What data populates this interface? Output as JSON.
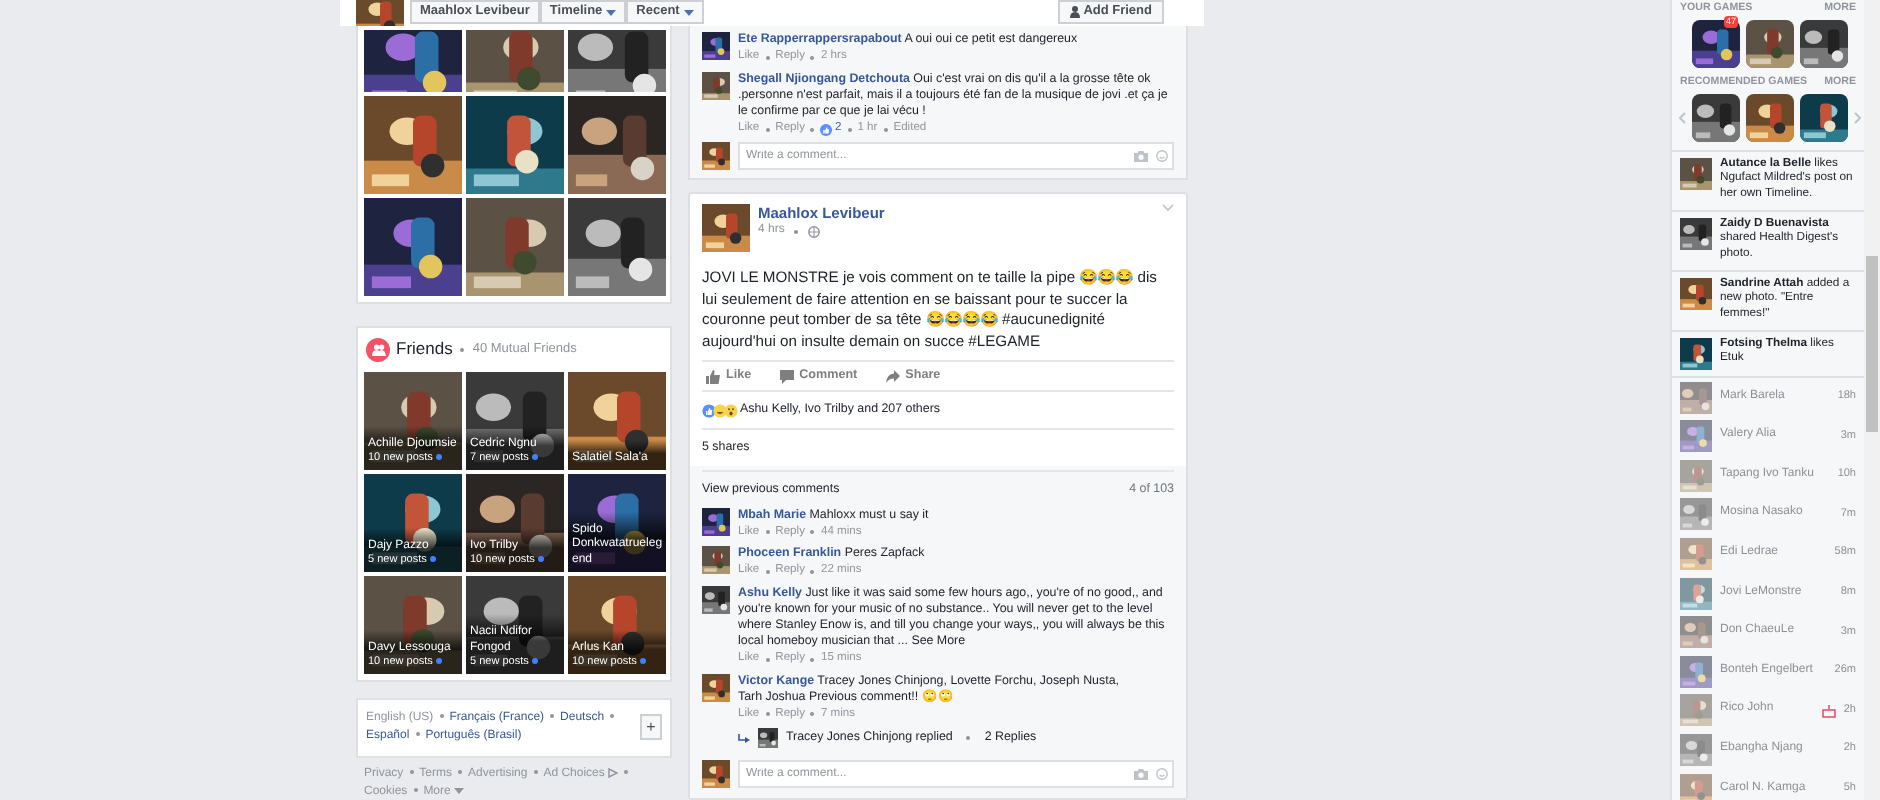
{
  "profile_bar": {
    "name": "Maahlox Levibeur",
    "menus": [
      {
        "label": "Timeline"
      },
      {
        "label": "Recent"
      }
    ],
    "add_friend": "Add Friend"
  },
  "friends": {
    "title": "Friends",
    "subtitle": "40 Mutual Friends",
    "items": [
      {
        "name": "Achille Djoumsie",
        "posts": "10 new posts"
      },
      {
        "name": "Cedric Ngnu",
        "posts": "7 new posts"
      },
      {
        "name": "Salatiel Sala'a"
      },
      {
        "name": "Dajy Pazzo",
        "posts": "5 new posts"
      },
      {
        "name": "Ivo Trilby",
        "posts": "10 new posts"
      },
      {
        "name": "Spido Donkwatatruelegend"
      },
      {
        "name": "Davy Lessouga",
        "posts": "10 new posts"
      },
      {
        "name": "Nacii Ndifor Fongod",
        "posts": "5 new posts"
      },
      {
        "name": "Arlus Kan",
        "posts": "10 new posts"
      }
    ]
  },
  "languages": {
    "items": [
      {
        "label": "English (US)",
        "selected": true
      },
      {
        "label": "Français (France)",
        "selected": false
      },
      {
        "label": "Deutsch",
        "selected": false
      },
      {
        "label": "Español",
        "selected": false
      },
      {
        "label": "Português (Brasil)",
        "selected": false
      }
    ],
    "add": "+"
  },
  "footer_links": [
    "Privacy",
    "Terms",
    "Advertising",
    "Ad Choices",
    "Cookies",
    "More"
  ],
  "previous_post": {
    "comments": [
      {
        "author": "Ete Rapperrappersrapabout",
        "text": "A oui oui ce petit est dangereux",
        "actions": [
          "Like",
          "Reply"
        ],
        "time": "2 hrs"
      },
      {
        "author": "Shegall Njiongang Detchouta",
        "text": "Oui c'est vrai on dis qu'il a la grosse tête ok .personne n'est parfait, mais il a toujours été fan de la musique de jovi .et ça je le confirme par ce que je lai vécu !",
        "actions": [
          "Like",
          "Reply"
        ],
        "likes": "2",
        "time": "1 hr",
        "edited": "Edited"
      }
    ],
    "composer": {
      "placeholder": "Write a comment..."
    }
  },
  "post": {
    "author": "Maahlox Levibeur",
    "time": "4 hrs",
    "parts": [
      {
        "kind": "text",
        "text": "JOVI LE MONSTRE je vois comment on te taille la pipe 😂😂😂 dis lui seulement de faire attention en se baissant pour te succer la couronne peut tomber de sa tête 😂😂😂😂 "
      },
      {
        "kind": "hashtag",
        "text": "#aucunedignité"
      },
      {
        "kind": "text",
        "text": " aujourd'hui on insulte demain on succe "
      },
      {
        "kind": "hashtag",
        "text": "#LEGAME"
      }
    ],
    "actions": [
      "Like",
      "Comment",
      "Share"
    ],
    "reactions": "Ashu Kelly, Ivo Trilby and 207 others",
    "shares": "5 shares",
    "view_previous": "View previous comments",
    "comment_count": "4 of 103",
    "comments": [
      {
        "author": "Mbah Marie",
        "text": "Mahloxx must u say it",
        "actions": [
          "Like",
          "Reply"
        ],
        "time": "44 mins"
      },
      {
        "author": "Phoceen Franklin",
        "mentions": [
          "Peres Zapfack"
        ],
        "actions": [
          "Like",
          "Reply"
        ],
        "time": "22 mins"
      },
      {
        "author": "Ashu Kelly",
        "text": "Just like it was said some few hours ago,, you're of no good,, and you're known for your music of no substance.. You will never get to the level where Stanley Enow is, and till you change your ways,, you will always be this local homeboy musician that ...",
        "see_more": "See More",
        "actions": [
          "Like",
          "Reply"
        ],
        "time": "15 mins"
      },
      {
        "author": "Victor Kange",
        "mentions": [
          "Tracey Jones Chinjong,",
          "Lovette Forchu,",
          "Joseph Nusta,",
          "Tarh Joshua"
        ],
        "text": "Previous comment!! 🙄🙄",
        "actions": [
          "Like",
          "Reply"
        ],
        "time": "7 mins"
      }
    ],
    "replies": {
      "text": "Tracey Jones Chinjong replied",
      "count": "2 Replies"
    },
    "composer": {
      "placeholder": "Write a comment..."
    }
  },
  "sidebar": {
    "your_games": {
      "title": "YOUR GAMES",
      "more": "MORE",
      "badge": "47"
    },
    "recommended_games": {
      "title": "RECOMMENDED GAMES",
      "more": "MORE"
    },
    "ticker": [
      {
        "actor": "Autance la Belle",
        "text": "likes Ngufact Mildred's post on her own Timeline."
      },
      {
        "actor": "Zaidy D Buenavista",
        "text": "shared Health Digest's photo."
      },
      {
        "actor": "Sandrine Attah",
        "text": "added a new photo. \"Entre femmes!\""
      },
      {
        "actor": "Fotsing Thelma",
        "text": "likes Etuk"
      }
    ],
    "chat": [
      {
        "name": "Mark Barela",
        "time": "18h",
        "birthday": false
      },
      {
        "name": "Valery Alia",
        "time": "3m",
        "birthday": false
      },
      {
        "name": "Tapang Ivo Tanku",
        "time": "10h",
        "birthday": false
      },
      {
        "name": "Mosina Nasako",
        "time": "7m",
        "birthday": false
      },
      {
        "name": "Edi Ledrae",
        "time": "58m",
        "birthday": false
      },
      {
        "name": "Jovi LeMonstre",
        "time": "8m",
        "birthday": false
      },
      {
        "name": "Don ChaeuLe",
        "time": "3m",
        "birthday": false
      },
      {
        "name": "Bonteh Engelbert",
        "time": "26m",
        "birthday": false
      },
      {
        "name": "Rico John",
        "time": "2h",
        "birthday": true
      },
      {
        "name": "Ebangha Njang",
        "time": "2h",
        "birthday": false
      },
      {
        "name": "Carol N. Kamga",
        "time": "5h",
        "birthday": false
      }
    ]
  }
}
